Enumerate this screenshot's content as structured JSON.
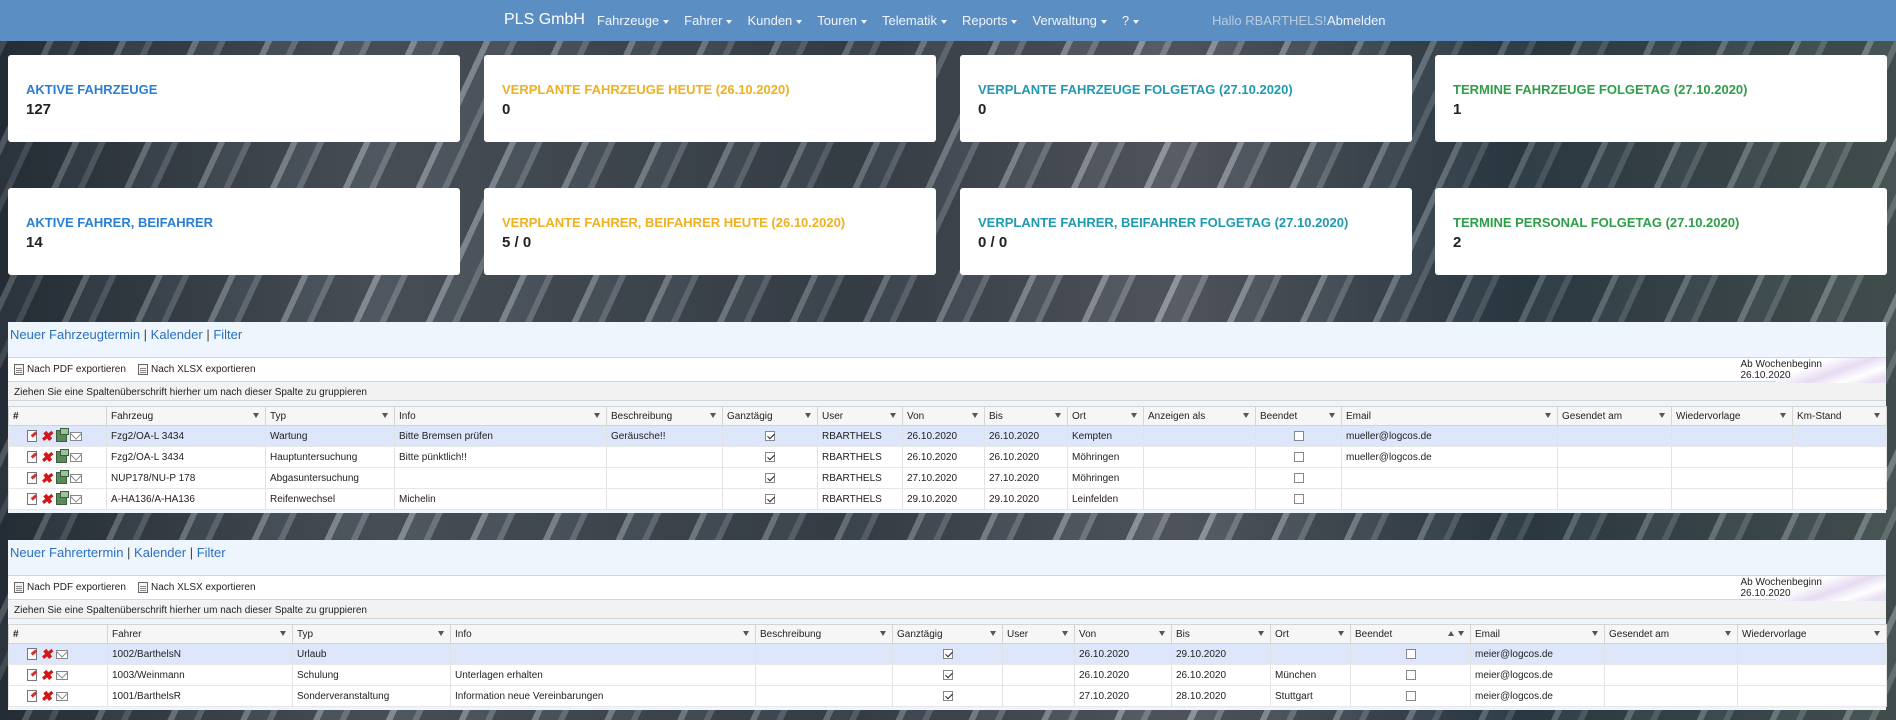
{
  "nav": {
    "brand": "PLS GmbH",
    "menu": [
      "Fahrzeuge",
      "Fahrer",
      "Kunden",
      "Touren",
      "Telematik",
      "Reports",
      "Verwaltung",
      "?"
    ],
    "greeting": "Hallo RBARTHELS!",
    "logout": "Abmelden"
  },
  "cards": [
    {
      "label": "AKTIVE FAHRZEUGE",
      "value": "127",
      "color": "#2a7fd4"
    },
    {
      "label": "VERPLANTE FAHRZEUGE HEUTE (26.10.2020)",
      "value": "0",
      "color": "#f0b020"
    },
    {
      "label": "VERPLANTE FAHRZEUGE FOLGETAG (27.10.2020)",
      "value": "0",
      "color": "#1f9ab0"
    },
    {
      "label": "TERMINE FAHRZEUGE FOLGETAG (27.10.2020)",
      "value": "1",
      "color": "#2e9e48"
    },
    {
      "label": "AKTIVE FAHRER, BEIFAHRER",
      "value": "14",
      "color": "#2a7fd4"
    },
    {
      "label": "VERPLANTE FAHRER, BEIFAHRER HEUTE (26.10.2020)",
      "value": "5 / 0",
      "color": "#f0b020"
    },
    {
      "label": "VERPLANTE FAHRER, BEIFAHRER FOLGETAG (27.10.2020)",
      "value": "0 / 0",
      "color": "#1f9ab0"
    },
    {
      "label": "TERMINE PERSONAL FOLGETAG (27.10.2020)",
      "value": "2",
      "color": "#2e9e48"
    }
  ],
  "vehicle_grid": {
    "link_new": "Neuer Fahrzeugtermin",
    "link_calendar": "Kalender",
    "link_filter": "Filter",
    "export_pdf": "Nach PDF exportieren",
    "export_xlsx": "Nach XLSX exportieren",
    "week_label": "Ab Wochenbeginn",
    "week_date": "26.10.2020",
    "group_hint": "Ziehen Sie eine Spaltenüberschrift hierher um nach dieser Spalte zu gruppieren",
    "columns": [
      "#",
      "Fahrzeug",
      "Typ",
      "Info",
      "Beschreibung",
      "Ganztägig",
      "User",
      "Von",
      "Bis",
      "Ort",
      "Anzeigen als",
      "Beendet",
      "Email",
      "Gesendet am",
      "Wiedervorlage",
      "Km-Stand"
    ],
    "rows": [
      {
        "fahrzeug": "Fzg2/OA-L 3434",
        "typ": "Wartung",
        "info": "Bitte Bremsen prüfen",
        "beschreibung": "Geräusche!!",
        "ganztaegig": true,
        "user": "RBARTHELS",
        "von": "26.10.2020",
        "bis": "26.10.2020",
        "ort": "Kempten",
        "anzeigen": "",
        "beendet": false,
        "email": "mueller@logcos.de",
        "gesendet": "",
        "wiedervorlage": "",
        "km": ""
      },
      {
        "fahrzeug": "Fzg2/OA-L 3434",
        "typ": "Hauptuntersuchung",
        "info": "Bitte pünktlich!!",
        "beschreibung": "",
        "ganztaegig": true,
        "user": "RBARTHELS",
        "von": "26.10.2020",
        "bis": "26.10.2020",
        "ort": "Möhringen",
        "anzeigen": "",
        "beendet": false,
        "email": "mueller@logcos.de",
        "gesendet": "",
        "wiedervorlage": "",
        "km": ""
      },
      {
        "fahrzeug": "NUP178/NU-P 178",
        "typ": "Abgasuntersuchung",
        "info": "",
        "beschreibung": "",
        "ganztaegig": true,
        "user": "RBARTHELS",
        "von": "27.10.2020",
        "bis": "27.10.2020",
        "ort": "Möhringen",
        "anzeigen": "",
        "beendet": false,
        "email": "",
        "gesendet": "",
        "wiedervorlage": "",
        "km": ""
      },
      {
        "fahrzeug": "A-HA136/A-HA136",
        "typ": "Reifenwechsel",
        "info": "Michelin",
        "beschreibung": "",
        "ganztaegig": true,
        "user": "RBARTHELS",
        "von": "29.10.2020",
        "bis": "29.10.2020",
        "ort": "Leinfelden",
        "anzeigen": "",
        "beendet": false,
        "email": "",
        "gesendet": "",
        "wiedervorlage": "",
        "km": ""
      }
    ]
  },
  "driver_grid": {
    "link_new": "Neuer Fahrertermin",
    "link_calendar": "Kalender",
    "link_filter": "Filter",
    "export_pdf": "Nach PDF exportieren",
    "export_xlsx": "Nach XLSX exportieren",
    "week_label": "Ab Wochenbeginn",
    "week_date": "26.10.2020",
    "group_hint": "Ziehen Sie eine Spaltenüberschrift hierher um nach dieser Spalte zu gruppieren",
    "columns": [
      "#",
      "Fahrer",
      "Typ",
      "Info",
      "Beschreibung",
      "Ganztägig",
      "User",
      "Von",
      "Bis",
      "Ort",
      "Beendet",
      "Email",
      "Gesendet am",
      "Wiedervorlage"
    ],
    "rows": [
      {
        "fahrer": "1002/BarthelsN",
        "typ": "Urlaub",
        "info": "",
        "beschreibung": "",
        "ganztaegig": true,
        "user": "",
        "von": "26.10.2020",
        "bis": "29.10.2020",
        "ort": "",
        "beendet": false,
        "email": "meier@logcos.de",
        "gesendet": "",
        "wiedervorlage": ""
      },
      {
        "fahrer": "1003/Weinmann",
        "typ": "Schulung",
        "info": "Unterlagen erhalten",
        "beschreibung": "",
        "ganztaegig": true,
        "user": "",
        "von": "26.10.2020",
        "bis": "26.10.2020",
        "ort": "München",
        "beendet": false,
        "email": "meier@logcos.de",
        "gesendet": "",
        "wiedervorlage": ""
      },
      {
        "fahrer": "1001/BarthelsR",
        "typ": "Sonderveranstaltung",
        "info": "Information neue Vereinbarungen",
        "beschreibung": "",
        "ganztaegig": true,
        "user": "",
        "von": "27.10.2020",
        "bis": "28.10.2020",
        "ort": "Stuttgart",
        "beendet": false,
        "email": "meier@logcos.de",
        "gesendet": "",
        "wiedervorlage": ""
      }
    ]
  }
}
